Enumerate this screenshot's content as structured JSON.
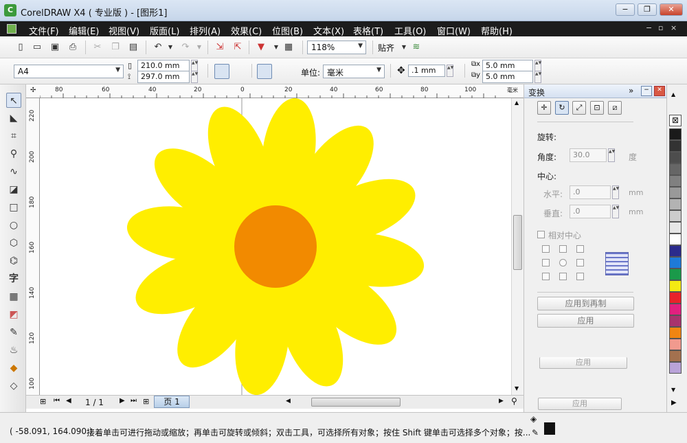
{
  "window": {
    "title": "CorelDRAW X4 ( 专业版 ) - [图形1]",
    "minimize": "−",
    "maximize": "❐",
    "close": "✕"
  },
  "menu": [
    "文件(F)",
    "编辑(E)",
    "视图(V)",
    "版面(L)",
    "排列(A)",
    "效果(C)",
    "位图(B)",
    "文本(X)",
    "表格(T)",
    "工具(O)",
    "窗口(W)",
    "帮助(H)"
  ],
  "toolbar": {
    "zoom": "118%",
    "snap_label": "贴齐"
  },
  "property_bar": {
    "page_size": "A4",
    "width": "210.0 mm",
    "height": "297.0 mm",
    "units_label": "单位:",
    "units": "毫米",
    "nudge": ".1 mm",
    "dup_x": "5.0 mm",
    "dup_y": "5.0 mm"
  },
  "ruler": {
    "top": [
      "80",
      "60",
      "40",
      "20",
      "0",
      "20",
      "40",
      "60",
      "80",
      "100"
    ],
    "left": [
      "220",
      "200",
      "180",
      "160",
      "140",
      "120",
      "100"
    ],
    "unit": "毫米"
  },
  "page_nav": {
    "counter": "1 / 1",
    "page_tab": "页 1"
  },
  "docker": {
    "title": "变换",
    "section_rotation": "旋转:",
    "angle_label": "角度:",
    "angle_value": "30.0",
    "angle_unit": "度",
    "center_label": "中心:",
    "h_label": "水平:",
    "h_value": ".0",
    "v_label": "垂直:",
    "v_value": ".0",
    "mm": "mm",
    "relative_center": "相对中心",
    "apply_to_dup": "应用到再制",
    "apply": "应用",
    "ghost_apply_1": "应用",
    "ghost_apply_2": "应用"
  },
  "palette": [
    "#1a1a1a",
    "#333333",
    "#4d4d4d",
    "#666666",
    "#808080",
    "#999999",
    "#b3b3b3",
    "#cccccc",
    "#e6e6e6",
    "#ffffff",
    "#2b2b8c",
    "#1e7ad8",
    "#1a9a4a",
    "#f3ea13",
    "#e8232a",
    "#e2207f",
    "#a8336d",
    "#f08512",
    "#f19a8e",
    "#a3714f",
    "#b9a3d8"
  ],
  "colors": {
    "petal": "#ffee00",
    "center": "#f28a00"
  },
  "status": {
    "coords": "( -58.091, 164.090 )",
    "hint": "接着单击可进行拖动或缩放；再单击可旋转或倾斜；双击工具，可选择所有对象；按住 Shift 键单击可选择多个对象；按..."
  }
}
